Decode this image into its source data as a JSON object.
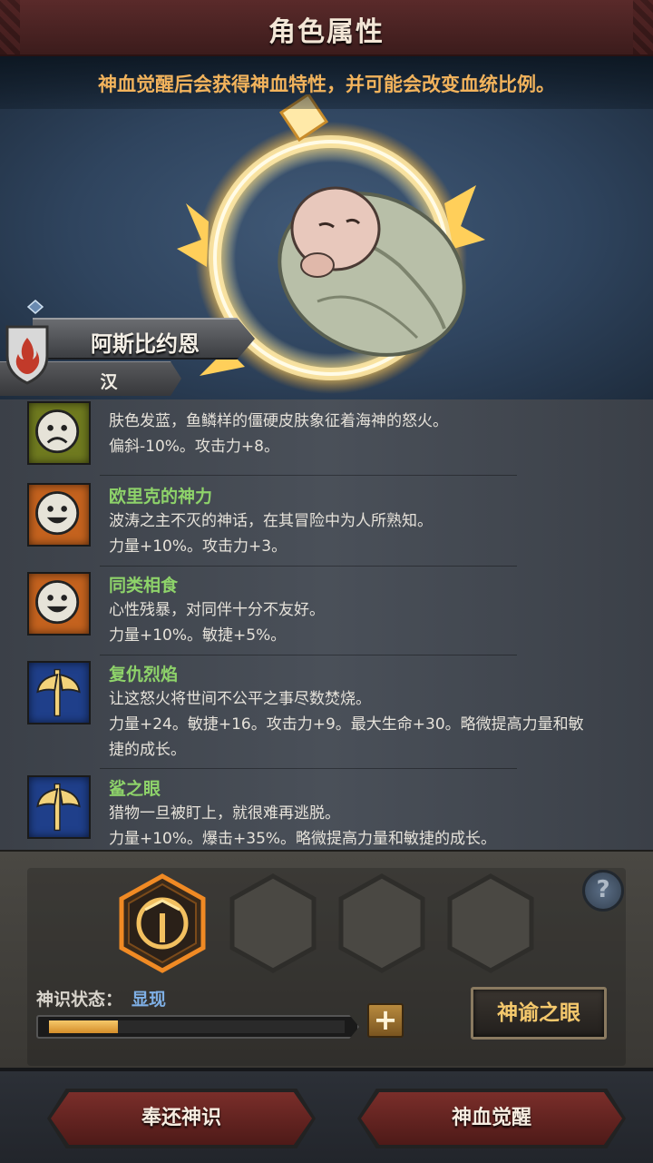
{
  "header": {
    "title": "角色属性"
  },
  "hero": {
    "notice": "神血觉醒后会获得神血特性，并可能会改变血统比例。",
    "character_name": "阿斯比约恩",
    "race": "汉"
  },
  "traits": [
    {
      "name": "",
      "icon": "sad-face-icon",
      "icon_bg": "#6f7a1f",
      "desc1": "肤色发蓝，鱼鳞样的僵硬皮肤象征着海神的怒火。",
      "desc2": "偏斜-10%。攻击力+8。",
      "desc3": ""
    },
    {
      "name": "欧里克的神力",
      "icon": "smile-face-icon",
      "icon_bg": "#c4621e",
      "desc1": "波涛之主不灭的神话，在其冒险中为人所熟知。",
      "desc2": "力量+10%。攻击力+3。",
      "desc3": ""
    },
    {
      "name": "同类相食",
      "icon": "smile-face-icon",
      "icon_bg": "#c4621e",
      "desc1": "心性残暴，对同伴十分不友好。",
      "desc2": "力量+10%。敏捷+5%。",
      "desc3": ""
    },
    {
      "name": "复仇烈焰",
      "icon": "axe-icon",
      "icon_bg": "#1f3f8a",
      "desc1": "让这怒火将世间不公平之事尽数焚烧。",
      "desc2": "力量+24。敏捷+16。攻击力+9。最大生命+30。略微提高力量和敏",
      "desc3": "捷的成长。"
    },
    {
      "name": "鲨之眼",
      "icon": "axe-icon",
      "icon_bg": "#1f3f8a",
      "desc1": "猎物一旦被盯上，就很难再逃脱。",
      "desc2": "力量+10%。爆击+35%。略微提高力量和敏捷的成长。",
      "desc3": ""
    }
  ],
  "panel": {
    "help": "?",
    "state_label": "神识状态：",
    "state_value": "显现",
    "progress": 0.23,
    "plus": "+",
    "oracle_button": "神谕之眼"
  },
  "footer": {
    "return_button": "奉还神识",
    "awaken_button": "神血觉醒"
  },
  "colors": {
    "accent": "#f2b35c",
    "trait_name": "#8ed36a",
    "state_value": "#7fb0e6"
  }
}
